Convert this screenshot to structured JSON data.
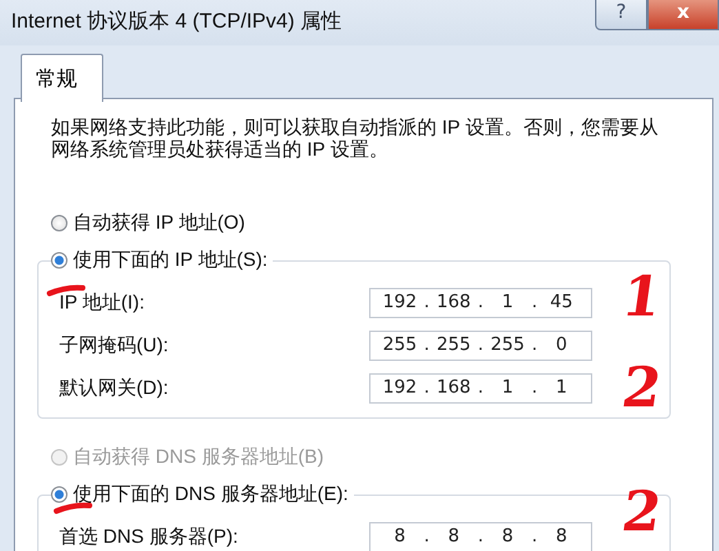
{
  "window": {
    "title": "Internet 协议版本 4 (TCP/IPv4) 属性",
    "buttons": [
      {
        "kind": "help",
        "label": "?"
      },
      {
        "kind": "close",
        "label": "x"
      }
    ]
  },
  "tabs": [
    {
      "label": "常规",
      "selected": true
    }
  ],
  "description": "如果网络支持此功能，则可以获取自动指派的 IP 设置。否则，您需要从网络系统管理员处获得适当的 IP 设置。",
  "sections": [
    {
      "options": [
        {
          "label": "自动获得 IP 地址(O)",
          "selected": false,
          "disabled": false
        },
        {
          "label": "使用下面的 IP 地址(S):",
          "selected": true,
          "disabled": false
        }
      ],
      "fields": [
        {
          "label": "IP 地址(I):",
          "octets": [
            "192",
            "168",
            "1",
            "45"
          ]
        },
        {
          "label": "子网掩码(U):",
          "octets": [
            "255",
            "255",
            "255",
            "0"
          ]
        },
        {
          "label": "默认网关(D):",
          "octets": [
            "192",
            "168",
            "1",
            "1"
          ]
        }
      ]
    },
    {
      "options": [
        {
          "label": "自动获得 DNS 服务器地址(B)",
          "selected": false,
          "disabled": true
        },
        {
          "label": "使用下面的 DNS 服务器地址(E):",
          "selected": true,
          "disabled": false
        }
      ],
      "fields": [
        {
          "label": "首选 DNS 服务器(P):",
          "octets": [
            "8",
            "8",
            "8",
            "8"
          ]
        }
      ]
    }
  ],
  "separator": ".",
  "annotations": [
    {
      "kind": "underline"
    },
    {
      "kind": "digit",
      "text": "1"
    },
    {
      "kind": "digit",
      "text": "2"
    },
    {
      "kind": "underline"
    },
    {
      "kind": "digit",
      "text": "2"
    }
  ]
}
